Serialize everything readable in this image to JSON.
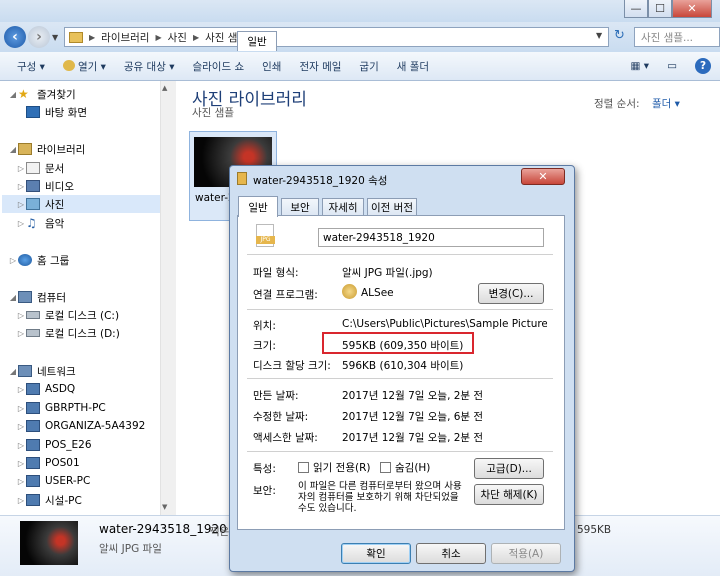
{
  "breadcrumb": [
    "라이브러리",
    "사진",
    "사진 샘플"
  ],
  "search": {
    "placeholder": "사진 샘플..."
  },
  "toolbar": {
    "items": [
      "구성",
      "열기",
      "공유 대상",
      "슬라이드 쇼",
      "인쇄",
      "전자 메일",
      "굽기",
      "새 폴더"
    ]
  },
  "sidebar": {
    "favorites": "즐겨찾기",
    "desktop": "바탕 화면",
    "libraries": "라이브러리",
    "docs": "문서",
    "video": "비디오",
    "photos": "사진",
    "music": "음악",
    "homegroup": "홈 그룹",
    "computer": "컴퓨터",
    "disk_c": "로컬 디스크 (C:)",
    "disk_d": "로컬 디스크 (D:)",
    "network": "네트워크",
    "net_items": [
      "ASDQ",
      "GBRPTH-PC",
      "ORGANIZA-5A4392",
      "POS_E26",
      "POS01",
      "USER-PC",
      "시설-PC"
    ]
  },
  "main": {
    "title": "사진 라이브러리",
    "subtitle": "사진 샘플",
    "sort_label": "정렬 순서:",
    "sort_value": "폴더",
    "thumb_label": "water-2"
  },
  "details": {
    "filename": "water-2943518_1920",
    "taken_prefix": "찍은",
    "filetype": "알씨 JPG 파일",
    "size": "595KB"
  },
  "dialog": {
    "title": "water-2943518_1920 속성",
    "tabs": [
      "일반",
      "보안",
      "자세히",
      "이전 버전"
    ],
    "filename": "water-2943518_1920",
    "file_type_label": "파일 형식:",
    "file_type": "알씨 JPG 파일(.jpg)",
    "open_with_label": "연결 프로그램:",
    "open_with": "ALSee",
    "change_button": "변경(C)...",
    "location_label": "위치:",
    "location": "C:\\Users\\Public\\Pictures\\Sample Picture",
    "size_label": "크기:",
    "size": "595KB (609,350 바이트)",
    "disk_size_label": "디스크 할당 크기:",
    "disk_size": "596KB (610,304 바이트)",
    "created_label": "만든 날짜:",
    "created": "2017년 12월 7일 오늘, 2분 전",
    "modified_label": "수정한 날짜:",
    "modified": "2017년 12월 7일 오늘, 6분 전",
    "accessed_label": "액세스한 날짜:",
    "accessed": "2017년 12월 7일 오늘, 2분 전",
    "attributes_label": "특성:",
    "readonly": "읽기 전용(R)",
    "hidden": "숨김(H)",
    "advanced_button": "고급(D)...",
    "security_label": "보안:",
    "security_text": "이 파일은 다른 컴퓨터로부터 왔으며 사용자의 컴퓨터를 보호하기 위해 차단되었을 수도 있습니다.",
    "unblock_button": "차단 해제(K)",
    "ok_button": "확인",
    "cancel_button": "취소",
    "apply_button": "적용(A)"
  },
  "colors": {
    "accent": "#1e5aa8",
    "highlight_box": "#d9262e",
    "selected": "#d9e8fa"
  }
}
